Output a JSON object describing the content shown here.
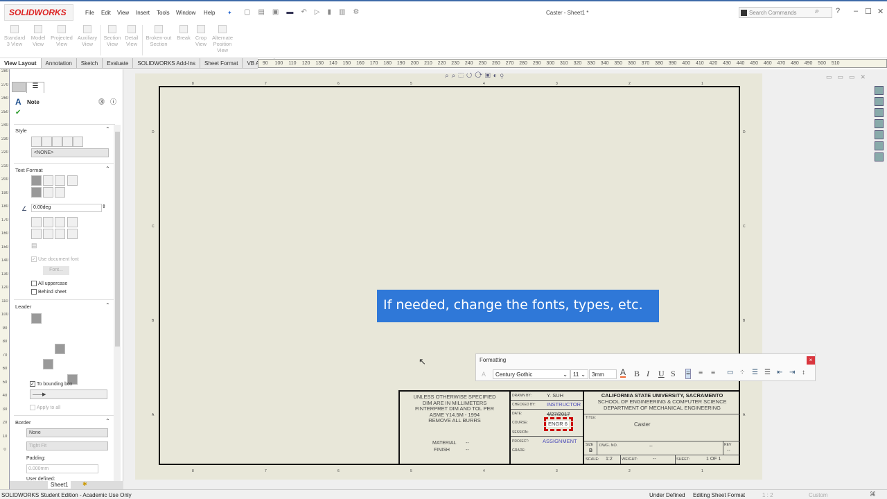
{
  "app": {
    "logo": "SOLIDWORKS",
    "title": "Caster - Sheet1 *",
    "search_placeholder": "Search Commands",
    "help": "?"
  },
  "menu": [
    "File",
    "Edit",
    "View",
    "Insert",
    "Tools",
    "Window",
    "Help"
  ],
  "ribbon": [
    {
      "label": "Standard 3 View"
    },
    {
      "label": "Model View"
    },
    {
      "label": "Projected View"
    },
    {
      "label": "Auxiliary View"
    },
    {
      "label": "Section View"
    },
    {
      "label": "Detail View"
    },
    {
      "label": "Broken-out Section"
    },
    {
      "label": "Break"
    },
    {
      "label": "Crop View"
    },
    {
      "label": "Alternate Position View"
    }
  ],
  "tabs": [
    "View Layout",
    "Annotation",
    "Sketch",
    "Evaluate",
    "SOLIDWORKS Add-Ins",
    "Sheet Format",
    "VB Addin"
  ],
  "hruler": [
    "90",
    "100",
    "110",
    "120",
    "130",
    "140",
    "150",
    "160",
    "170",
    "180",
    "190",
    "200",
    "210",
    "220",
    "230",
    "240",
    "250",
    "260",
    "270",
    "280",
    "290",
    "300",
    "310",
    "320",
    "330",
    "340",
    "350",
    "360",
    "370",
    "380",
    "390",
    "400",
    "410",
    "420",
    "430",
    "440",
    "450",
    "460",
    "470",
    "480",
    "490",
    "500",
    "510"
  ],
  "vruler": [
    "280",
    "270",
    "260",
    "250",
    "240",
    "230",
    "220",
    "210",
    "200",
    "190",
    "180",
    "170",
    "160",
    "150",
    "140",
    "130",
    "120",
    "110",
    "100",
    "90",
    "80",
    "70",
    "60",
    "50",
    "40",
    "30",
    "20",
    "10",
    "0"
  ],
  "pm": {
    "title": "Note",
    "style_section": "Style",
    "style_value": "<NONE>",
    "text_format_section": "Text Format",
    "angle": "0.00deg",
    "use_doc_font": "Use document font",
    "font_button": "Font...",
    "all_uppercase": "All uppercase",
    "behind_sheet": "Behind sheet",
    "leader_section": "Leader",
    "to_bounding_box": "To bounding box",
    "apply_to_all": "Apply to all",
    "border_section": "Border",
    "border_style": "None",
    "border_size": "Tight Fit",
    "padding_label": "Padding:",
    "padding_value": "0.000mm",
    "user_defined": "User defined:"
  },
  "sheet": {
    "top_zones": [
      "8",
      "7",
      "6",
      "5",
      "4",
      "3",
      "2",
      "1"
    ],
    "side_zones": [
      "D",
      "C",
      "B",
      "A"
    ]
  },
  "titleblock": {
    "notes": [
      "UNLESS OTHERWISE SPECIFIED",
      "DIM ARE IN MILLIMETERS",
      "FINTERPRET DIM AND TOL PER",
      "ASME Y14.5M - 1994",
      "REMOVE ALL BURRS"
    ],
    "material_label": "MATERIAL",
    "material": "--",
    "finish_label": "FINISH",
    "finish": "--",
    "drawn_by_label": "DRAWN BY:",
    "drawn_by": "Y. SUH",
    "checked_by_label": "CHECKED BY:",
    "checked_by": "INSTRUCTOR",
    "date_label": "DATE:",
    "date": "4/27/2017",
    "course_label": "COURSE:",
    "course": "ENGR 6",
    "session_label": "SESSION:",
    "project_label": "PROJECT:",
    "project": "ASSIGNMENT",
    "grade_label": "GRADE:",
    "university": "CALIFORNIA STATE UNIVERSITY, SACRAMENTO",
    "school": "SCHOOL OF ENGINEERING & COMPUTER SCIENCE",
    "department": "DEPARTMENT OF MECHANICAL ENGINEERING",
    "title_label": "TITLE:",
    "title": "Caster",
    "size_label": "SIZE",
    "size": "B",
    "dwg_label": "DWG. NO.",
    "dwg": "--",
    "rev_label": "REV",
    "rev": "--",
    "scale_label": "SCALE:",
    "scale": "1:2",
    "weight_label": "WEIGHT:",
    "weight": "--",
    "sheet_label": "SHEET:",
    "sheet": "1 OF 1"
  },
  "callout": "If needed, change the fonts, types, etc.",
  "formatting": {
    "title": "Formatting",
    "font": "Century Gothic",
    "size": "11",
    "height": "3mm",
    "bold": "B",
    "italic": "I",
    "underline": "U",
    "strike": "S",
    "color": "A"
  },
  "sheet_tab": "Sheet1",
  "status": {
    "edition": "SOLIDWORKS Student Edition - Academic Use Only",
    "state": "Under Defined",
    "mode": "Editing Sheet Format",
    "scale": "1 : 2",
    "units": "Custom"
  }
}
